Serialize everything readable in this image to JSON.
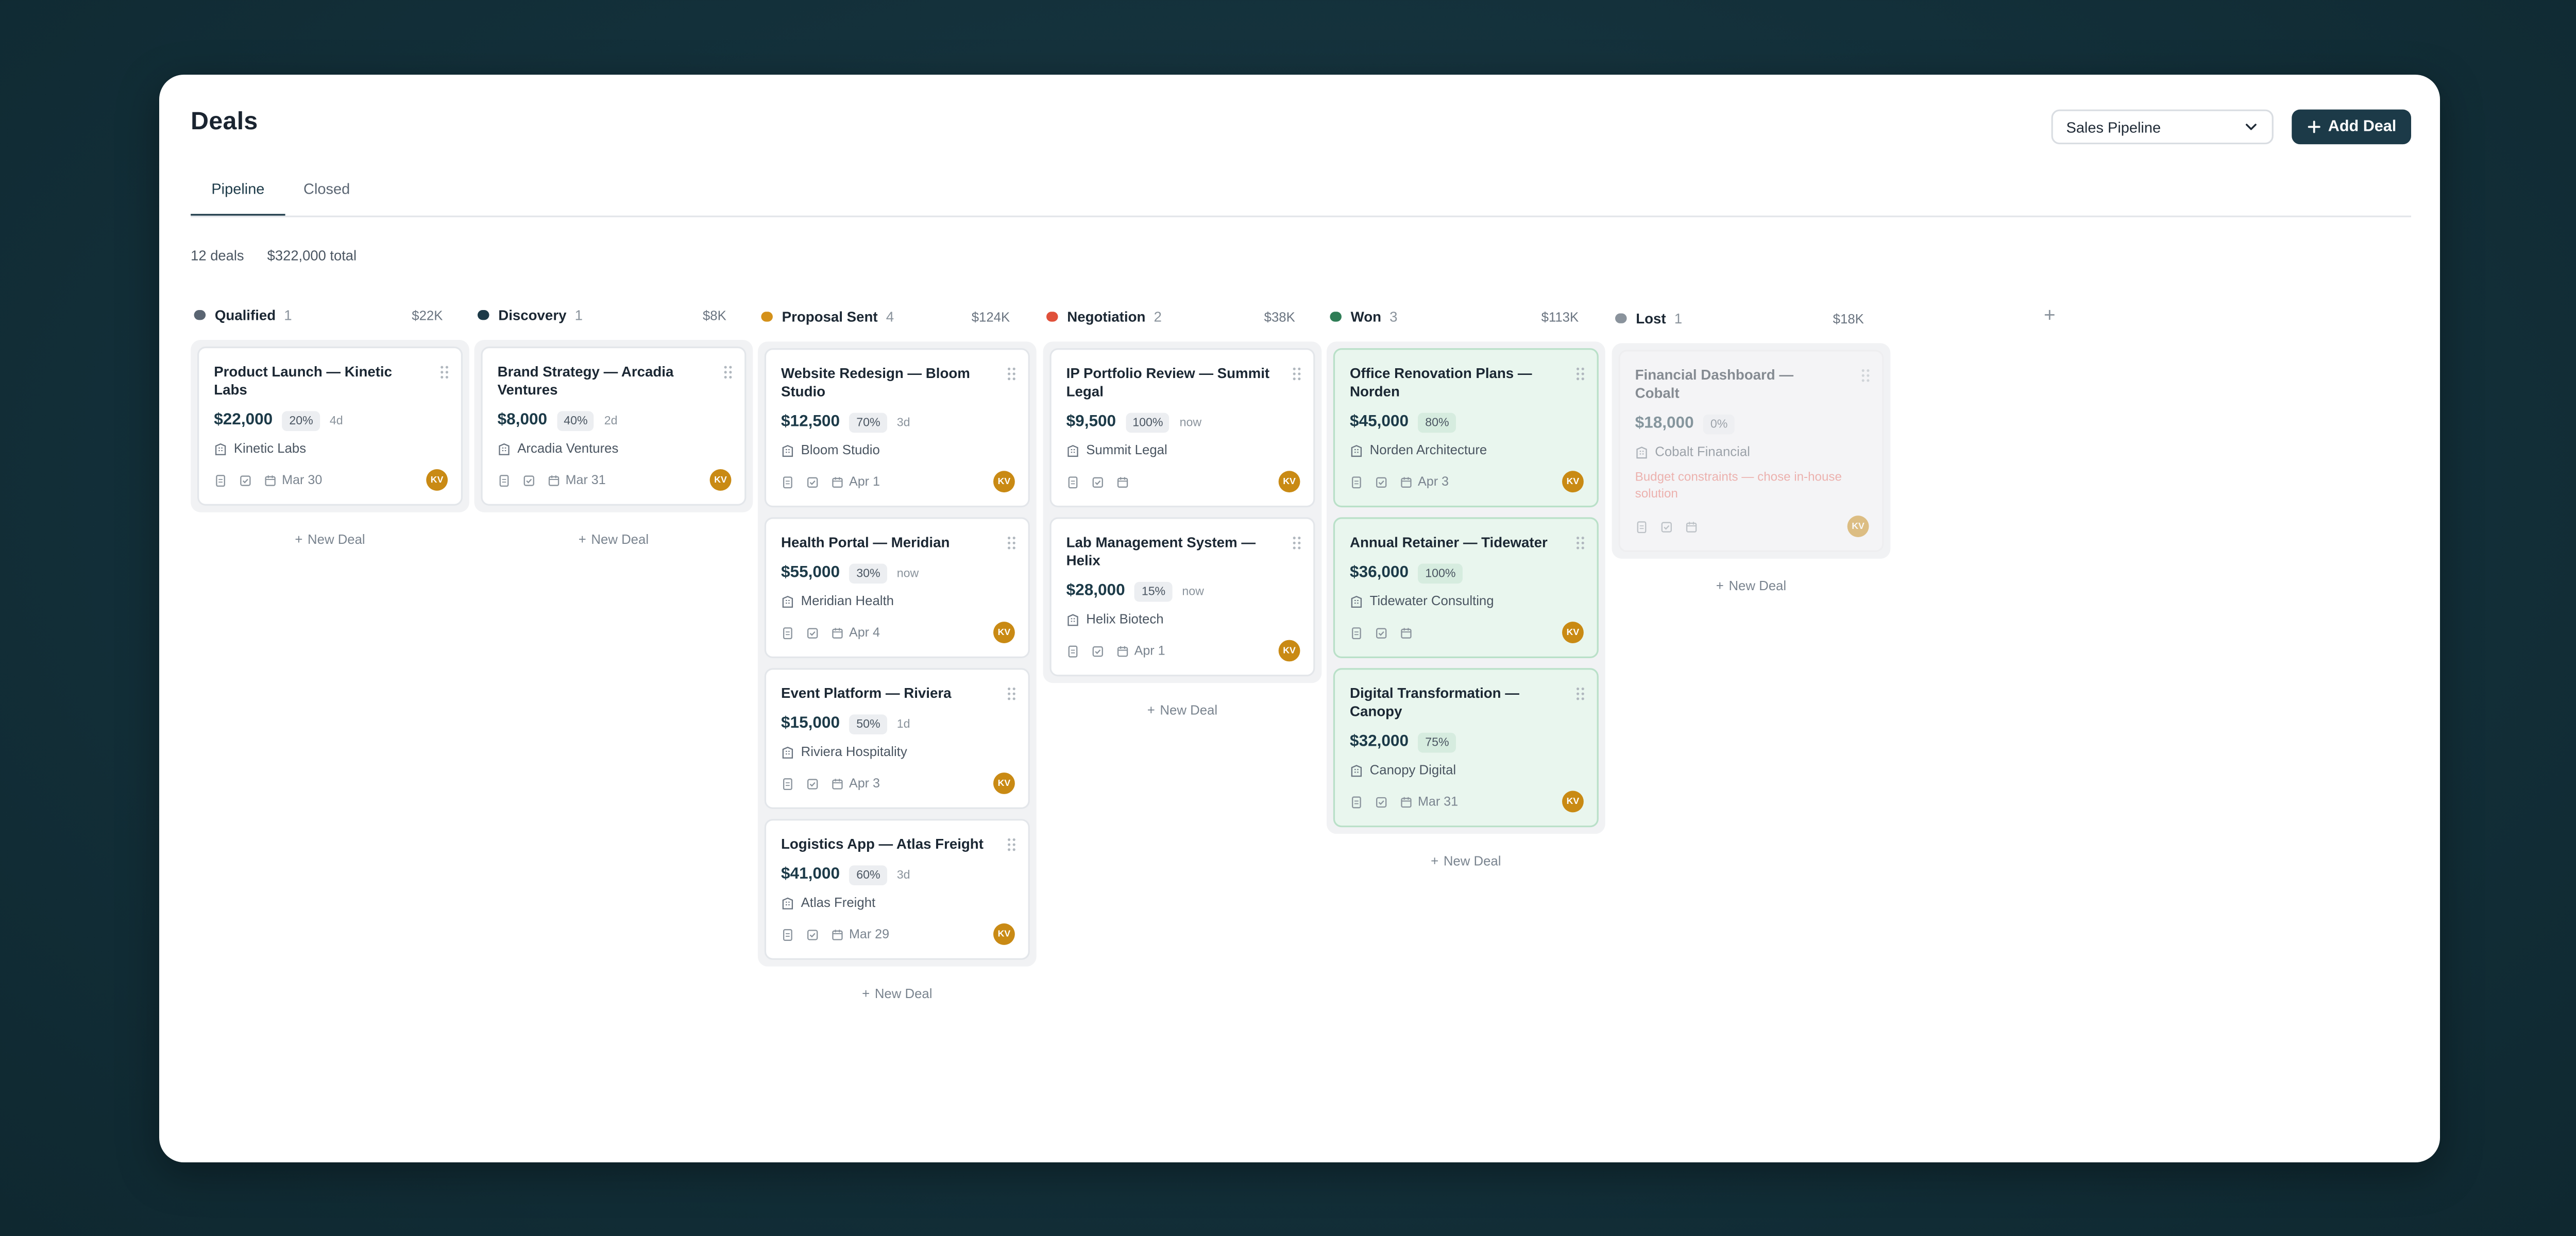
{
  "header": {
    "title": "Deals",
    "pipeline_select": "Sales Pipeline",
    "add_deal_label": "Add Deal"
  },
  "tabs": [
    {
      "label": "Pipeline",
      "active": true
    },
    {
      "label": "Closed",
      "active": false
    }
  ],
  "summary": {
    "count": "12 deals",
    "total": "$322,000 total"
  },
  "new_deal_label": "New Deal",
  "columns": [
    {
      "name": "Qualified",
      "count": "1",
      "total": "$22K",
      "color": "#5a6572",
      "cards": [
        {
          "title": "Product Launch — Kinetic Labs",
          "amount": "$22,000",
          "pct": "20%",
          "age": "4d",
          "company": "Kinetic Labs",
          "date": "Mar 30",
          "avatar": "KV"
        }
      ]
    },
    {
      "name": "Discovery",
      "count": "1",
      "total": "$8K",
      "color": "#1c3a48",
      "cards": [
        {
          "title": "Brand Strategy — Arcadia Ventures",
          "amount": "$8,000",
          "pct": "40%",
          "age": "2d",
          "company": "Arcadia Ventures",
          "date": "Mar 31",
          "avatar": "KV"
        }
      ]
    },
    {
      "name": "Proposal Sent",
      "count": "4",
      "total": "$124K",
      "color": "#d4911a",
      "cards": [
        {
          "title": "Website Redesign — Bloom Studio",
          "amount": "$12,500",
          "pct": "70%",
          "age": "3d",
          "company": "Bloom Studio",
          "date": "Apr 1",
          "avatar": "KV"
        },
        {
          "title": "Health Portal — Meridian",
          "amount": "$55,000",
          "pct": "30%",
          "age": "now",
          "company": "Meridian Health",
          "date": "Apr 4",
          "avatar": "KV"
        },
        {
          "title": "Event Platform — Riviera",
          "amount": "$15,000",
          "pct": "50%",
          "age": "1d",
          "company": "Riviera Hospitality",
          "date": "Apr 3",
          "avatar": "KV"
        },
        {
          "title": "Logistics App — Atlas Freight",
          "amount": "$41,000",
          "pct": "60%",
          "age": "3d",
          "company": "Atlas Freight",
          "date": "Mar 29",
          "avatar": "KV"
        }
      ]
    },
    {
      "name": "Negotiation",
      "count": "2",
      "total": "$38K",
      "color": "#e0503a",
      "cards": [
        {
          "title": "IP Portfolio Review — Summit Legal",
          "amount": "$9,500",
          "pct": "100%",
          "age": "now",
          "company": "Summit Legal",
          "date": "",
          "avatar": "KV"
        },
        {
          "title": "Lab Management System — Helix",
          "amount": "$28,000",
          "pct": "15%",
          "age": "now",
          "company": "Helix Biotech",
          "date": "Apr 1",
          "avatar": "KV"
        }
      ]
    },
    {
      "name": "Won",
      "count": "3",
      "total": "$113K",
      "color": "#2f7d56",
      "cards": [
        {
          "title": "Office Renovation Plans — Norden",
          "amount": "$45,000",
          "pct": "80%",
          "age": "",
          "company": "Norden Architecture",
          "date": "Apr 3",
          "avatar": "KV"
        },
        {
          "title": "Annual Retainer — Tidewater",
          "amount": "$36,000",
          "pct": "100%",
          "age": "",
          "company": "Tidewater Consulting",
          "date": "",
          "avatar": "KV"
        },
        {
          "title": "Digital Transformation — Canopy",
          "amount": "$32,000",
          "pct": "75%",
          "age": "",
          "company": "Canopy Digital",
          "date": "Mar 31",
          "avatar": "KV"
        }
      ]
    },
    {
      "name": "Lost",
      "count": "1",
      "total": "$18K",
      "color": "#8a939c",
      "cards": [
        {
          "title": "Financial Dashboard — Cobalt",
          "amount": "$18,000",
          "pct": "0%",
          "age": "",
          "company": "Cobalt Financial",
          "reason": "Budget constraints — chose in-house solution",
          "date": "",
          "avatar": "KV"
        }
      ]
    }
  ]
}
